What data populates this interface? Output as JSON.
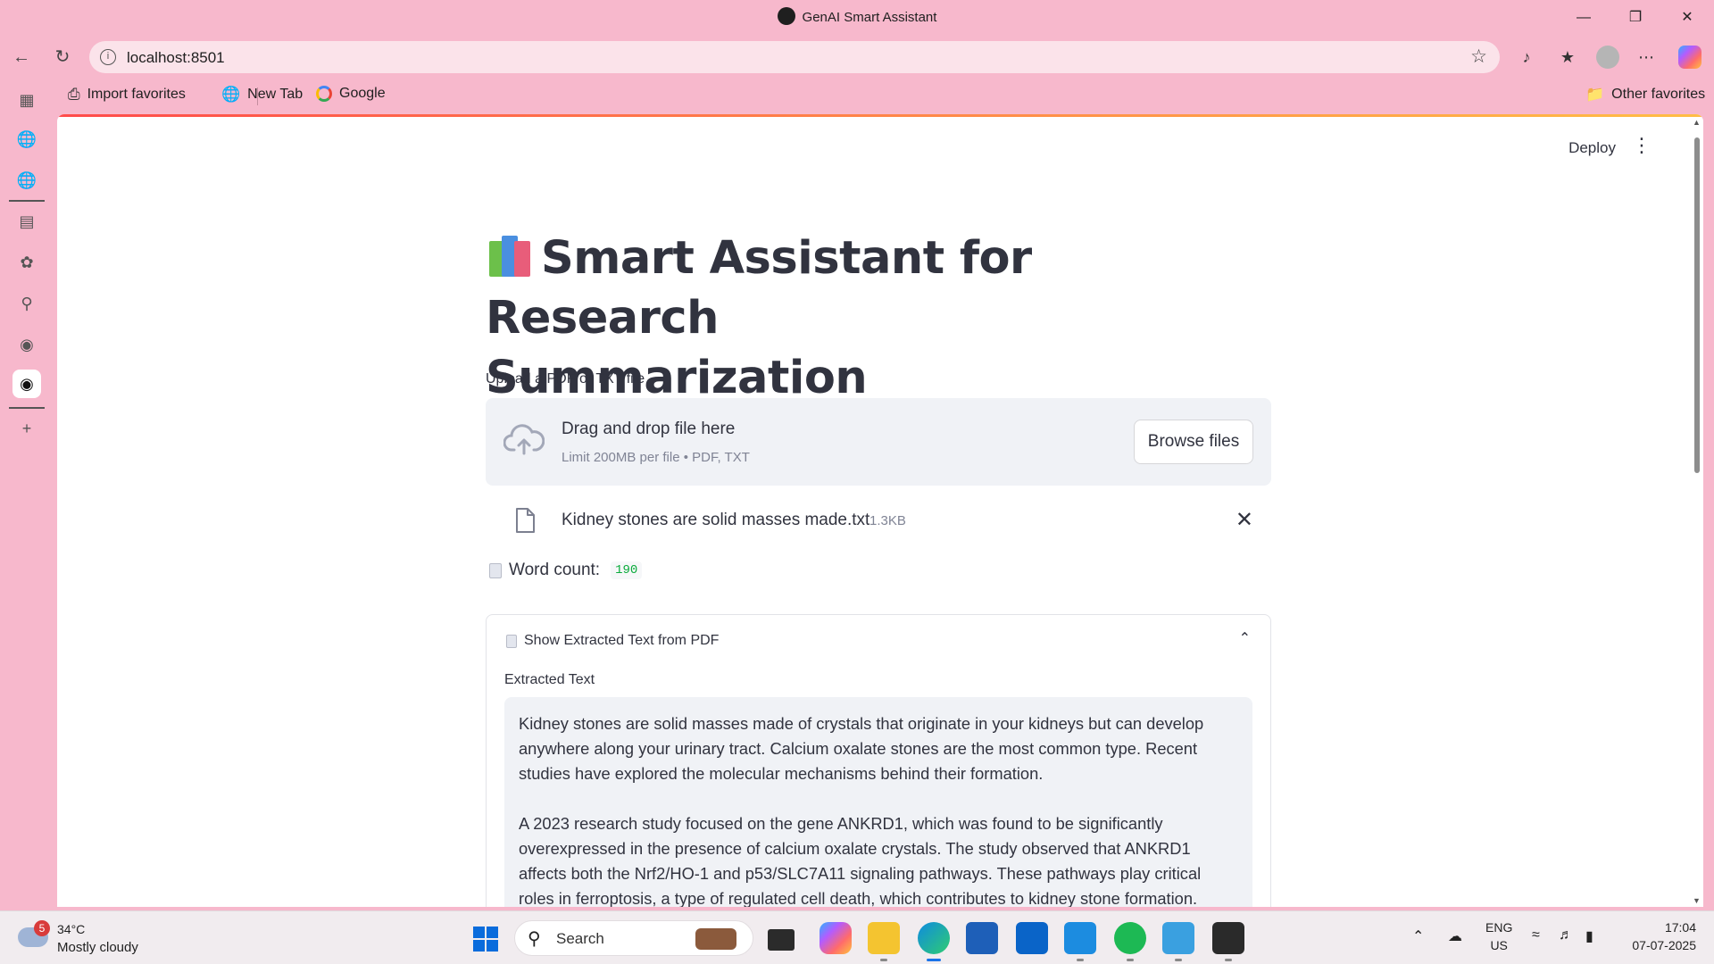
{
  "window": {
    "title": "GenAI Smart Assistant"
  },
  "browser": {
    "url": "localhost:8501",
    "favorites": [
      {
        "label": "Import favorites",
        "icon": "import-icon"
      },
      {
        "label": "New Tab",
        "icon": "globe-icon"
      },
      {
        "label": "Google",
        "icon": "google-icon"
      }
    ],
    "other_favorites": "Other favorites"
  },
  "app": {
    "deploy_label": "Deploy",
    "title_line1": "Smart Assistant for Research",
    "title_line2": "Summarization",
    "upload": {
      "label": "Upload a PDF or TXT file",
      "drag_text": "Drag and drop file here",
      "limit_text": "Limit 200MB per file • PDF, TXT",
      "browse_label": "Browse files"
    },
    "file": {
      "name": "Kidney stones are solid masses made.txt",
      "size": "1.3KB"
    },
    "word_count": {
      "label": "Word count:",
      "value": "190"
    },
    "expander": {
      "title": "Show Extracted Text from PDF",
      "text_label": "Extracted Text",
      "paragraphs": [
        "Kidney stones are solid masses made of crystals that originate in your kidneys but can develop anywhere along your urinary tract. Calcium oxalate stones are the most common type. Recent studies have explored the molecular mechanisms behind their formation.",
        "A 2023 research study focused on the gene ANKRD1, which was found to be significantly overexpressed in the presence of calcium oxalate crystals. The study observed that ANKRD1 affects both the Nrf2/HO-1 and p53/SLC7A11 signaling pathways. These pathways play critical roles in ferroptosis, a type of regulated cell death, which contributes to kidney stone formation."
      ]
    }
  },
  "taskbar": {
    "weather_temp": "34°C",
    "weather_cond": "Mostly cloudy",
    "weather_badge": "5",
    "search_placeholder": "Search",
    "lang_line1": "ENG",
    "lang_line2": "US",
    "time": "17:04",
    "date": "07-07-2025"
  }
}
